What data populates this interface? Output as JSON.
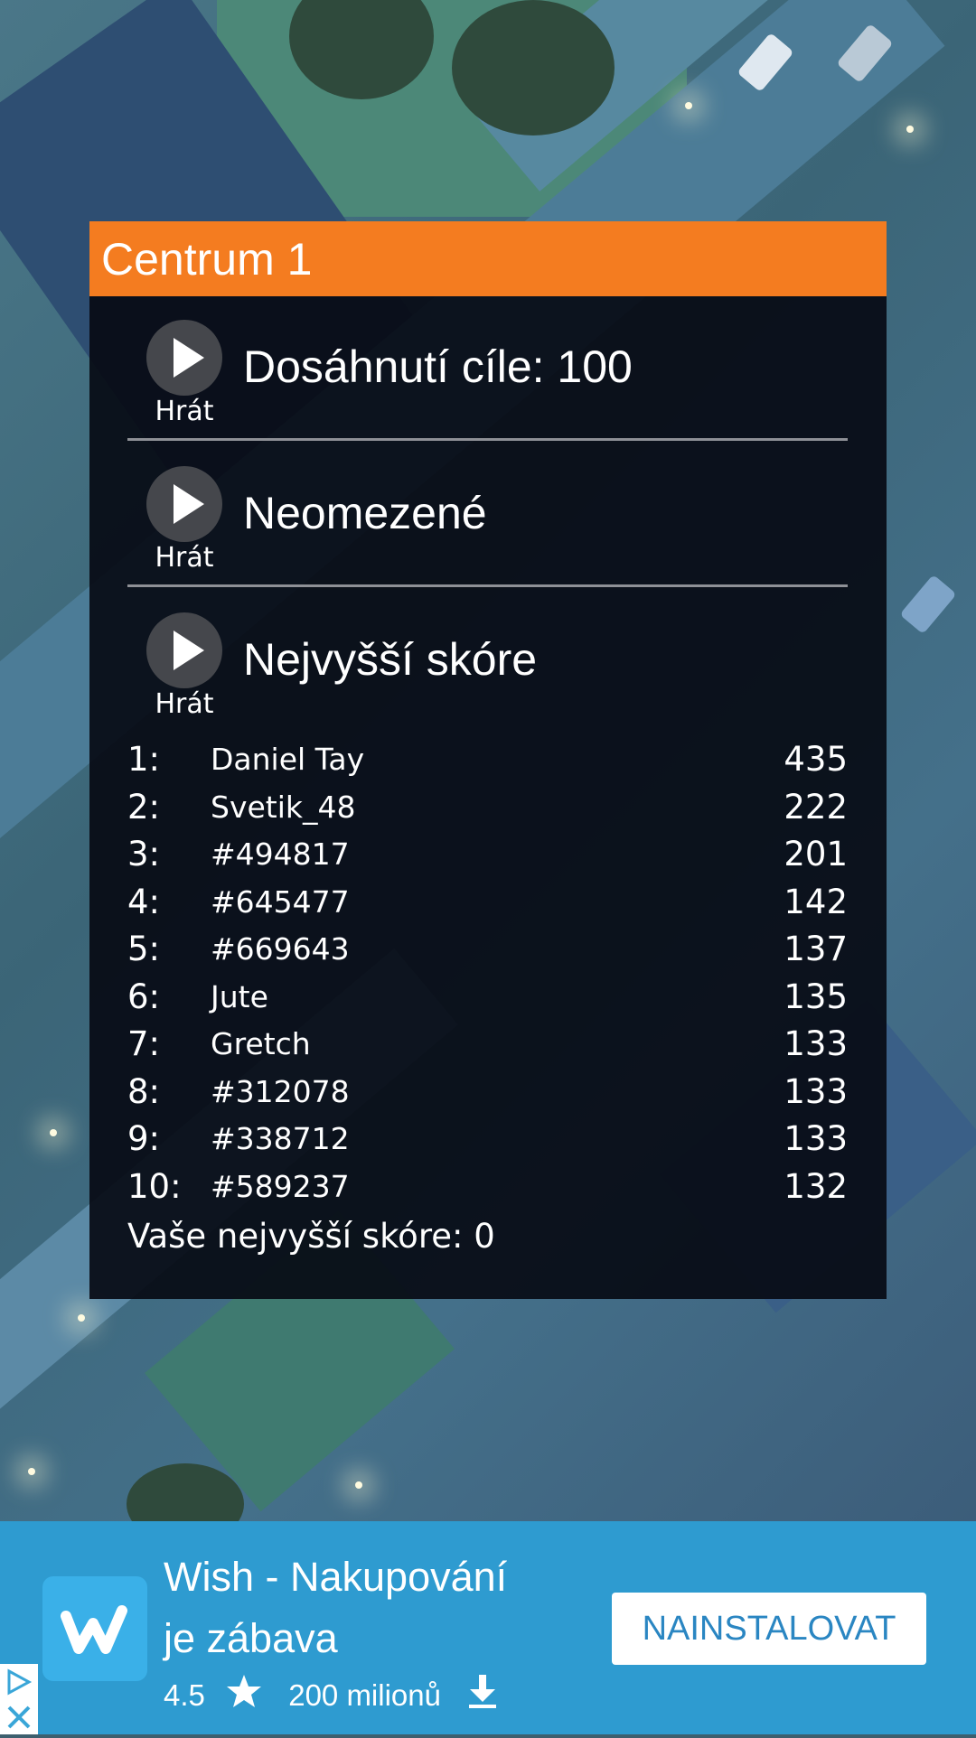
{
  "level": {
    "title": "Centrum 1"
  },
  "modes": [
    {
      "label": "Dosáhnutí cíle: 100",
      "play_label": "Hrát",
      "icon": "play-icon"
    },
    {
      "label": "Neomezené",
      "play_label": "Hrát",
      "icon": "play-icon"
    },
    {
      "label": "Nejvyšší skóre",
      "play_label": "Hrát",
      "icon": "play-icon"
    }
  ],
  "leaderboard": [
    {
      "rank": "1:",
      "name": "Daniel Tay",
      "score": "435"
    },
    {
      "rank": "2:",
      "name": "Svetik_48",
      "score": "222"
    },
    {
      "rank": "3:",
      "name": "#494817",
      "score": "201"
    },
    {
      "rank": "4:",
      "name": "#645477",
      "score": "142"
    },
    {
      "rank": "5:",
      "name": "#669643",
      "score": "137"
    },
    {
      "rank": "6:",
      "name": "Jute",
      "score": "135"
    },
    {
      "rank": "7:",
      "name": "Gretch",
      "score": "133"
    },
    {
      "rank": "8:",
      "name": "#312078",
      "score": "133"
    },
    {
      "rank": "9:",
      "name": "#338712",
      "score": "133"
    },
    {
      "rank": "10:",
      "name": "#589237",
      "score": "132"
    }
  ],
  "your_best": "Vaše nejvyšší skóre: 0",
  "ad": {
    "title_line1": "Wish - Nakupování",
    "title_line2": "je zábava",
    "rating": "4.5",
    "rating_icon": "star-icon",
    "installs": "200 milionů",
    "installs_icon": "download-icon",
    "button_label": "NAINSTALOVAT",
    "logo_icon": "wish-logo-icon",
    "choices_icon": "adchoices-icon",
    "colors": {
      "background": "#2e9bd0",
      "button_text": "#2a86c2"
    }
  },
  "colors": {
    "header": "#f47c20",
    "panel": "#080b14"
  }
}
